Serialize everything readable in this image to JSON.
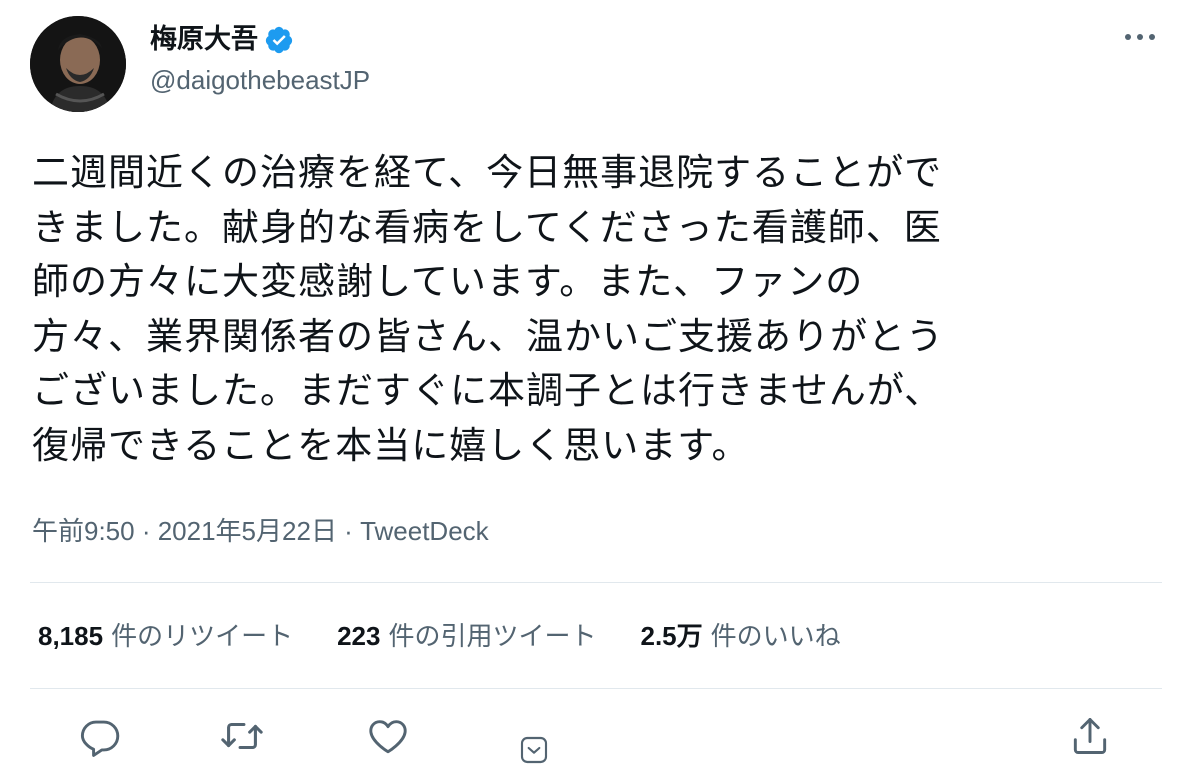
{
  "author": {
    "display_name": "梅原大吾",
    "handle": "@daigothebeastJP",
    "verified": true,
    "verified_color": "#1d9bf0"
  },
  "tweet": {
    "lines": [
      "二週間近くの治療を経て、今日無事退院することがで",
      "きました。献身的な看病をしてくださった看護師、医",
      "師の方々に大変感謝しています。また、ファンの",
      "方々、業界関係者の皆さん、温かいご支援ありがとう",
      "ございました。まだすぐに本調子とは行きませんが、",
      "復帰できることを本当に嬉しく思います。"
    ]
  },
  "meta": {
    "time": "午前9:50",
    "separator": " · ",
    "date": "2021年5月22日",
    "source": "TweetDeck"
  },
  "stats": {
    "retweets": {
      "count": "8,185",
      "label": "件のリツイート"
    },
    "quotes": {
      "count": "223",
      "label": "件の引用ツイート"
    },
    "likes": {
      "count": "2.5万",
      "label": "件のいいね"
    }
  },
  "icons": {
    "more": "more-horizontal-icon",
    "reply": "reply-icon",
    "retweet": "retweet-icon",
    "like": "heart-icon",
    "caret": "caret-down-icon",
    "share": "share-icon"
  },
  "colors": {
    "text": "#0f1419",
    "secondary": "#536471",
    "divider": "#e1e8ed"
  }
}
